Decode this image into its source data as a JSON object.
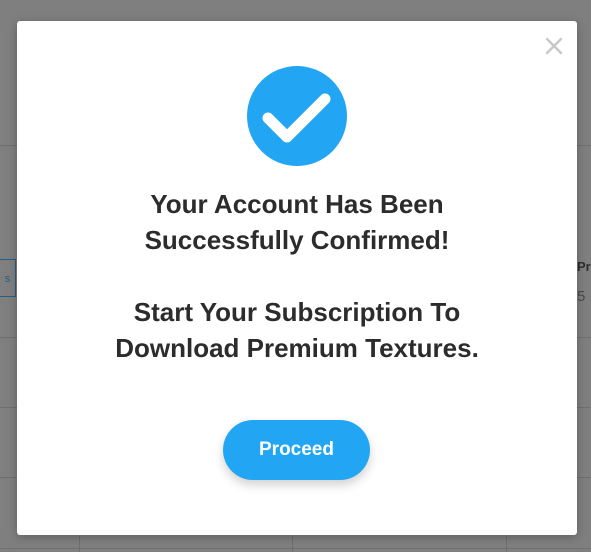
{
  "modal": {
    "close_icon": "close-icon",
    "status_icon": "checkmark-circle-icon",
    "heading_lines": [
      "Your Account Has Been",
      "Successfully Confirmed!",
      "Start Your Subscription To",
      "Download Premium Textures."
    ],
    "proceed_label": "Proceed"
  },
  "background": {
    "left_tab_label": "s",
    "right_header_fragment": "Pr",
    "right_value_fragment": "5"
  },
  "colors": {
    "accent": "#22a6f3",
    "overlay": "#7f7f7f",
    "text": "#2c2c2c",
    "close_icon": "#c8c8c8"
  }
}
